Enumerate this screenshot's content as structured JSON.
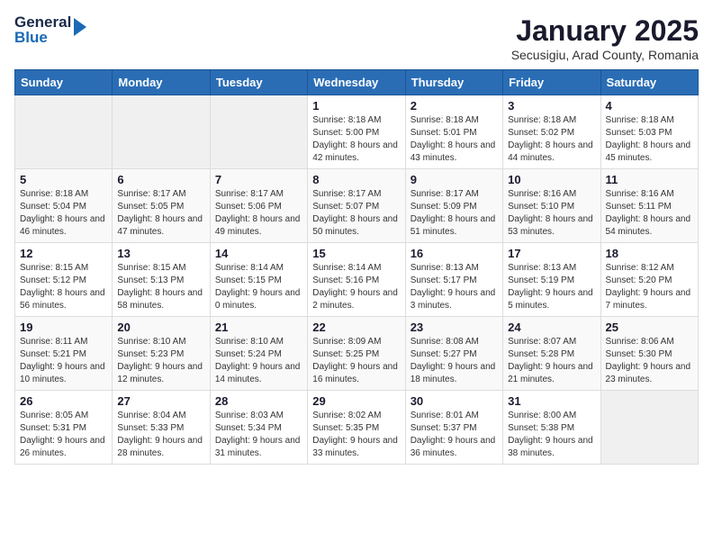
{
  "logo": {
    "line1": "General",
    "line2": "Blue"
  },
  "title": "January 2025",
  "subtitle": "Secusigiu, Arad County, Romania",
  "days_of_week": [
    "Sunday",
    "Monday",
    "Tuesday",
    "Wednesday",
    "Thursday",
    "Friday",
    "Saturday"
  ],
  "weeks": [
    [
      {
        "day": "",
        "info": ""
      },
      {
        "day": "",
        "info": ""
      },
      {
        "day": "",
        "info": ""
      },
      {
        "day": "1",
        "info": "Sunrise: 8:18 AM\nSunset: 5:00 PM\nDaylight: 8 hours and 42 minutes."
      },
      {
        "day": "2",
        "info": "Sunrise: 8:18 AM\nSunset: 5:01 PM\nDaylight: 8 hours and 43 minutes."
      },
      {
        "day": "3",
        "info": "Sunrise: 8:18 AM\nSunset: 5:02 PM\nDaylight: 8 hours and 44 minutes."
      },
      {
        "day": "4",
        "info": "Sunrise: 8:18 AM\nSunset: 5:03 PM\nDaylight: 8 hours and 45 minutes."
      }
    ],
    [
      {
        "day": "5",
        "info": "Sunrise: 8:18 AM\nSunset: 5:04 PM\nDaylight: 8 hours and 46 minutes."
      },
      {
        "day": "6",
        "info": "Sunrise: 8:17 AM\nSunset: 5:05 PM\nDaylight: 8 hours and 47 minutes."
      },
      {
        "day": "7",
        "info": "Sunrise: 8:17 AM\nSunset: 5:06 PM\nDaylight: 8 hours and 49 minutes."
      },
      {
        "day": "8",
        "info": "Sunrise: 8:17 AM\nSunset: 5:07 PM\nDaylight: 8 hours and 50 minutes."
      },
      {
        "day": "9",
        "info": "Sunrise: 8:17 AM\nSunset: 5:09 PM\nDaylight: 8 hours and 51 minutes."
      },
      {
        "day": "10",
        "info": "Sunrise: 8:16 AM\nSunset: 5:10 PM\nDaylight: 8 hours and 53 minutes."
      },
      {
        "day": "11",
        "info": "Sunrise: 8:16 AM\nSunset: 5:11 PM\nDaylight: 8 hours and 54 minutes."
      }
    ],
    [
      {
        "day": "12",
        "info": "Sunrise: 8:15 AM\nSunset: 5:12 PM\nDaylight: 8 hours and 56 minutes."
      },
      {
        "day": "13",
        "info": "Sunrise: 8:15 AM\nSunset: 5:13 PM\nDaylight: 8 hours and 58 minutes."
      },
      {
        "day": "14",
        "info": "Sunrise: 8:14 AM\nSunset: 5:15 PM\nDaylight: 9 hours and 0 minutes."
      },
      {
        "day": "15",
        "info": "Sunrise: 8:14 AM\nSunset: 5:16 PM\nDaylight: 9 hours and 2 minutes."
      },
      {
        "day": "16",
        "info": "Sunrise: 8:13 AM\nSunset: 5:17 PM\nDaylight: 9 hours and 3 minutes."
      },
      {
        "day": "17",
        "info": "Sunrise: 8:13 AM\nSunset: 5:19 PM\nDaylight: 9 hours and 5 minutes."
      },
      {
        "day": "18",
        "info": "Sunrise: 8:12 AM\nSunset: 5:20 PM\nDaylight: 9 hours and 7 minutes."
      }
    ],
    [
      {
        "day": "19",
        "info": "Sunrise: 8:11 AM\nSunset: 5:21 PM\nDaylight: 9 hours and 10 minutes."
      },
      {
        "day": "20",
        "info": "Sunrise: 8:10 AM\nSunset: 5:23 PM\nDaylight: 9 hours and 12 minutes."
      },
      {
        "day": "21",
        "info": "Sunrise: 8:10 AM\nSunset: 5:24 PM\nDaylight: 9 hours and 14 minutes."
      },
      {
        "day": "22",
        "info": "Sunrise: 8:09 AM\nSunset: 5:25 PM\nDaylight: 9 hours and 16 minutes."
      },
      {
        "day": "23",
        "info": "Sunrise: 8:08 AM\nSunset: 5:27 PM\nDaylight: 9 hours and 18 minutes."
      },
      {
        "day": "24",
        "info": "Sunrise: 8:07 AM\nSunset: 5:28 PM\nDaylight: 9 hours and 21 minutes."
      },
      {
        "day": "25",
        "info": "Sunrise: 8:06 AM\nSunset: 5:30 PM\nDaylight: 9 hours and 23 minutes."
      }
    ],
    [
      {
        "day": "26",
        "info": "Sunrise: 8:05 AM\nSunset: 5:31 PM\nDaylight: 9 hours and 26 minutes."
      },
      {
        "day": "27",
        "info": "Sunrise: 8:04 AM\nSunset: 5:33 PM\nDaylight: 9 hours and 28 minutes."
      },
      {
        "day": "28",
        "info": "Sunrise: 8:03 AM\nSunset: 5:34 PM\nDaylight: 9 hours and 31 minutes."
      },
      {
        "day": "29",
        "info": "Sunrise: 8:02 AM\nSunset: 5:35 PM\nDaylight: 9 hours and 33 minutes."
      },
      {
        "day": "30",
        "info": "Sunrise: 8:01 AM\nSunset: 5:37 PM\nDaylight: 9 hours and 36 minutes."
      },
      {
        "day": "31",
        "info": "Sunrise: 8:00 AM\nSunset: 5:38 PM\nDaylight: 9 hours and 38 minutes."
      },
      {
        "day": "",
        "info": ""
      }
    ]
  ]
}
